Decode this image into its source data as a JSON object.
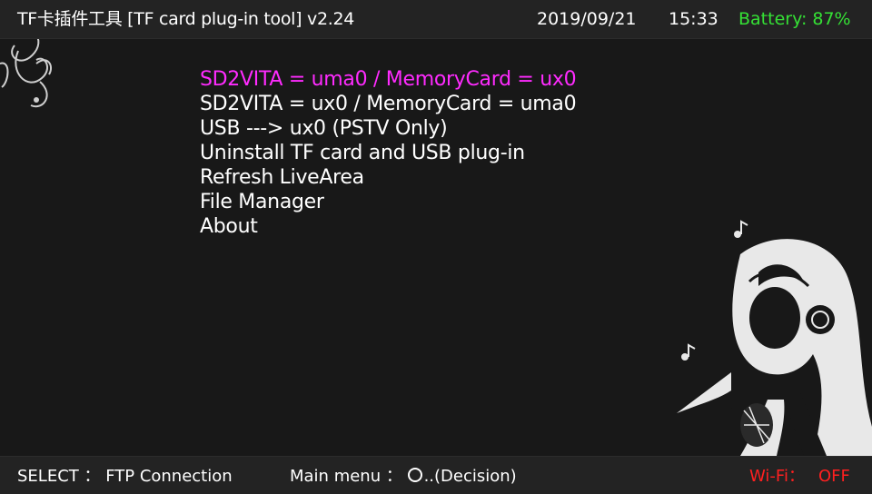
{
  "top_bar": {
    "title": "TF卡插件工具 [TF card plug-in tool] v2.24",
    "date": "2019/09/21",
    "time": "15:33",
    "battery": "Battery: 87%"
  },
  "menu": {
    "items": [
      {
        "label": "SD2VITA = uma0 / MemoryCard = ux0",
        "selected": true
      },
      {
        "label": "SD2VITA = ux0  / MemoryCard = uma0",
        "selected": false
      },
      {
        "label": "USB ---> ux0  (PSTV Only)",
        "selected": false
      },
      {
        "label": "Uninstall TF card and USB plug-in",
        "selected": false
      },
      {
        "label": "Refresh LiveArea",
        "selected": false
      },
      {
        "label": "File Manager",
        "selected": false
      },
      {
        "label": "About",
        "selected": false
      }
    ]
  },
  "bottom_bar": {
    "select_hint": "SELECT ： FTP Connection",
    "main_menu_prefix": "Main menu ：",
    "main_menu_suffix": "..(Decision)",
    "wifi_label": "Wi-Fi：",
    "wifi_value": "OFF"
  },
  "colors": {
    "selected": "#ff2bff",
    "battery": "#35e135",
    "wifi": "#ff2020"
  },
  "icons": [
    "circle-button-icon",
    "swirl-ornament-icon",
    "headphone-girl-illustration"
  ]
}
